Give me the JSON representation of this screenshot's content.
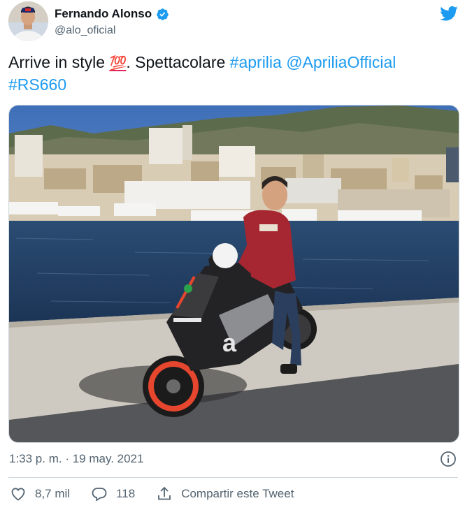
{
  "author": {
    "display_name": "Fernando Alonso",
    "handle": "@alo_oficial",
    "verified": true
  },
  "tweet": {
    "text_plain": "Arrive in style ",
    "emoji": "💯",
    "text_after_emoji": ". Spettacolare ",
    "hashtag_1": "#aprilia",
    "mention": "@ApriliaOfficial",
    "hashtag_2": "#RS660"
  },
  "timestamp": "1:33 p. m. · 19 may. 2021",
  "actions": {
    "likes": "8,7 mil",
    "replies": "118",
    "share_label": "Compartir este Tweet"
  },
  "colors": {
    "link": "#1d9bf0",
    "verified": "#1d9bf0",
    "secondary_text": "#536471"
  },
  "icons": [
    "twitter-bird-icon",
    "verified-badge-icon",
    "info-icon",
    "heart-icon",
    "reply-bubble-icon",
    "share-icon"
  ]
}
